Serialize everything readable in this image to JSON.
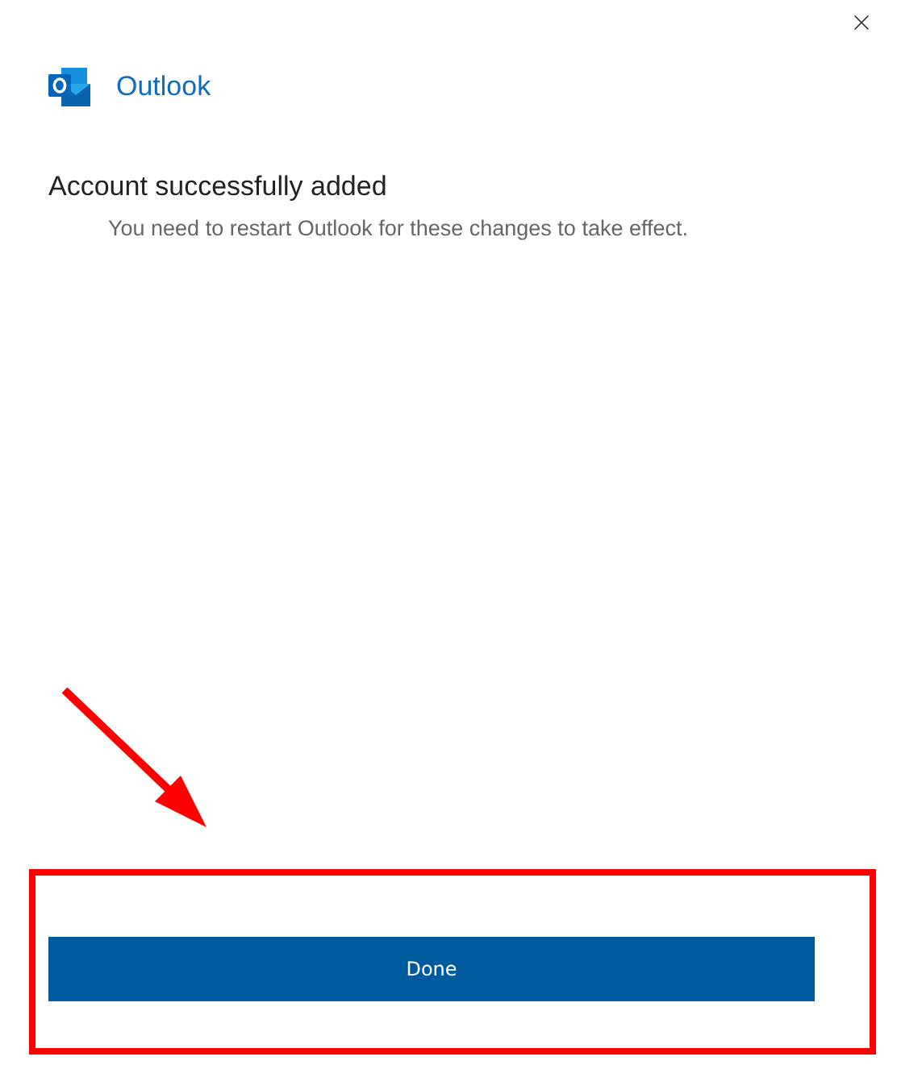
{
  "app": {
    "name": "Outlook"
  },
  "title": "Account successfully added",
  "message": "You need to restart Outlook for these changes to take effect.",
  "buttons": [
    {
      "label": "Done"
    }
  ]
}
